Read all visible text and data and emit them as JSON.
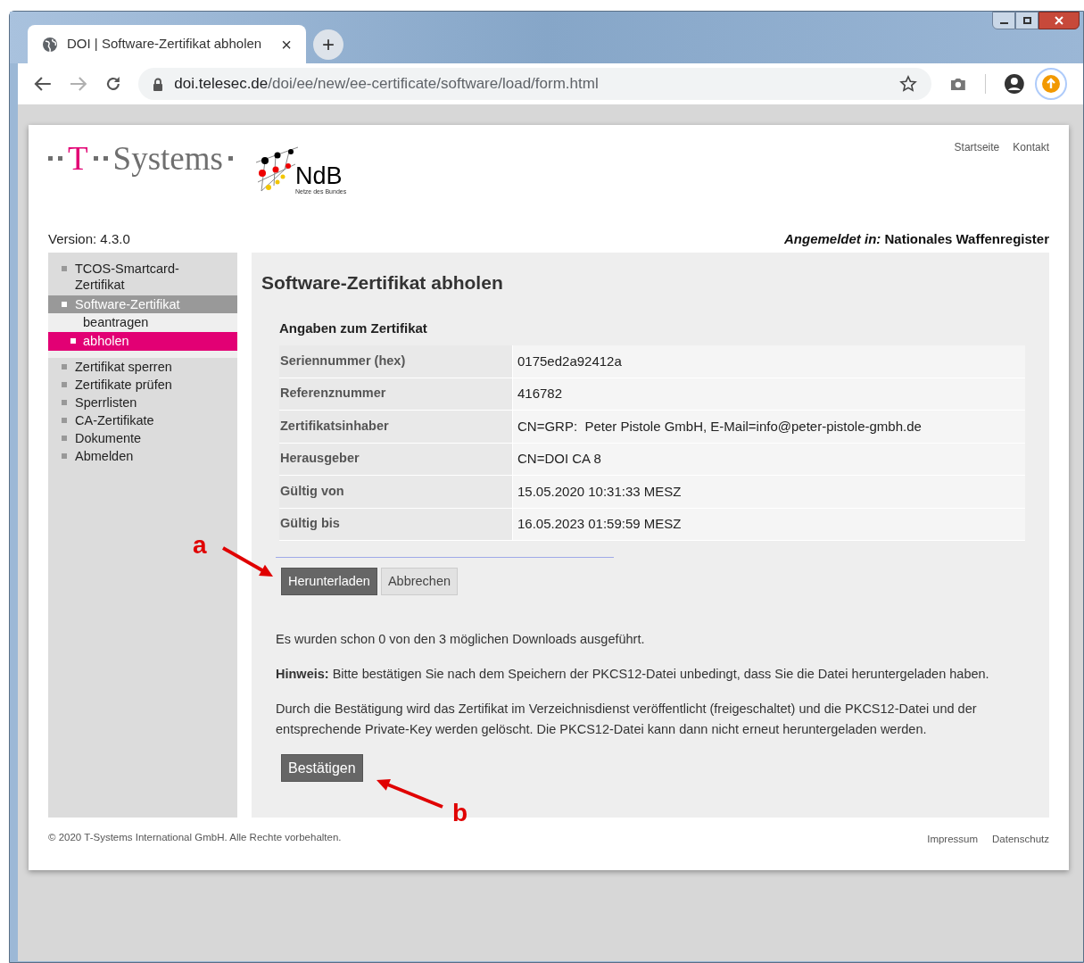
{
  "browser": {
    "tab_title": "DOI | Software-Zertifikat abholen",
    "tab_close": "×",
    "new_tab": "+",
    "url_host": "doi.telesec.de",
    "url_path": "/doi/ee/new/ee-certificate/software/load/form.html"
  },
  "header": {
    "logo": {
      "t": "T",
      "name": "Systems"
    },
    "ndb": {
      "title": "NdB",
      "subtitle": "Netze des Bundes"
    },
    "links": [
      "Startseite",
      "Kontakt"
    ],
    "version": "Version: 4.3.0",
    "login": "*Angemeldet in:* Nationales Waffenregister"
  },
  "sidebar": {
    "items": [
      {
        "label": "TCOS-Smartcard-Zertifikat",
        "selected": false
      },
      {
        "label": "Software-Zertifikat",
        "selected": false,
        "expanded": true,
        "children": [
          {
            "label": "beantragen",
            "selected": false
          },
          {
            "label": "abholen",
            "selected": true
          }
        ]
      },
      {
        "label": "Zertifikat sperren",
        "selected": false
      },
      {
        "label": "Zertifikate prüfen",
        "selected": false
      },
      {
        "label": "Sperrlisten",
        "selected": false
      },
      {
        "label": "CA-Zertifikate",
        "selected": false
      },
      {
        "label": "Dokumente",
        "selected": false
      },
      {
        "label": "Abmelden",
        "selected": false
      }
    ]
  },
  "main": {
    "title": "Software-Zertifikat abholen",
    "section": "Angaben zum Zertifikat",
    "rows": [
      {
        "label": "Seriennummer (hex)",
        "value": "0175ed2a92412a"
      },
      {
        "label": "Referenznummer",
        "value": "416782"
      },
      {
        "label": "Zertifikatsinhaber",
        "value": "CN=GRP:  Peter Pistole GmbH, E-Mail=info@peter-pistole-gmbh.de"
      },
      {
        "label": "Herausgeber",
        "value": "CN=DOI CA 8"
      },
      {
        "label": "Gültig von",
        "value": "15.05.2020 10:31:33 MESZ"
      },
      {
        "label": "Gültig bis",
        "value": "16.05.2023 01:59:59 MESZ"
      }
    ],
    "buttons": [
      {
        "label": "Herunterladen",
        "kind": "primary"
      },
      {
        "label": "Abbrechen",
        "kind": "secondary"
      }
    ],
    "paragraphs": [
      "Es wurden schon 0 von den 3 möglichen Downloads ausgeführt.",
      "**Hinweis:** Bitte bestätigen Sie nach dem Speichern der PKCS12-Datei unbedingt, dass Sie die Datei heruntergeladen haben.",
      "Durch die Bestätigung wird das Zertifikat im Verzeichnisdienst veröffentlicht (freigeschaltet) und die PKCS12-Datei und der entsprechende Private-Key werden gelöscht. Die PKCS12-Datei kann dann nicht erneut heruntergeladen werden."
    ],
    "confirm_button": "Bestätigen"
  },
  "footer": {
    "copyright": "© 2020 T-Systems International GmbH. Alle Rechte vorbehalten.",
    "links": [
      "Impressum",
      "Datenschutz"
    ]
  },
  "annotations": [
    {
      "label": "a",
      "kind": "download"
    },
    {
      "label": "b",
      "kind": "confirm"
    }
  ]
}
